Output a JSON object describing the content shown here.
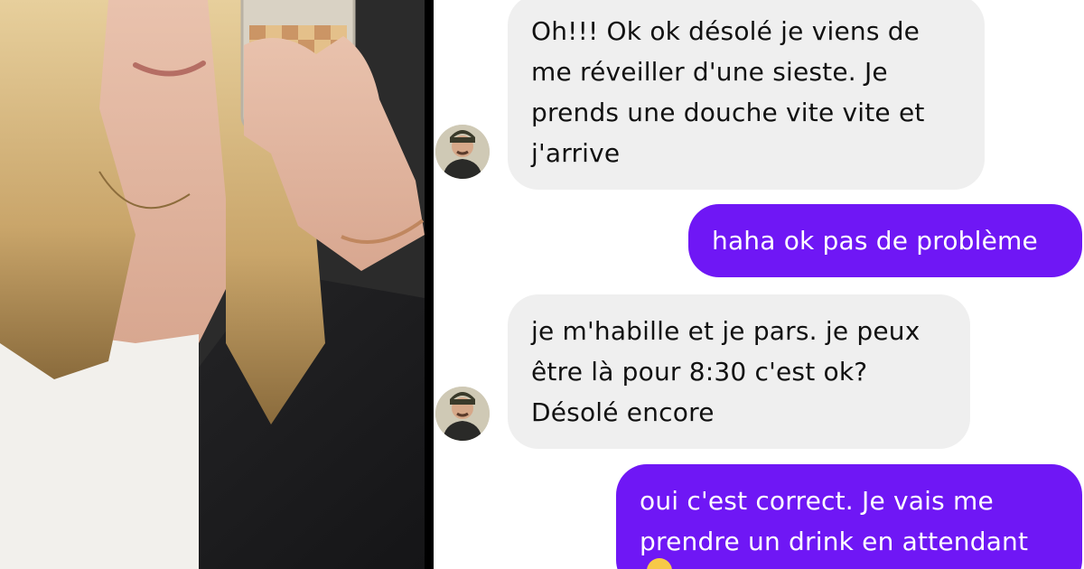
{
  "conversation": {
    "messages": [
      {
        "sender": "other",
        "text": "Oh!!! Ok ok désolé je viens de\nme réveiller d'une sieste. Je\nprends une douche vite vite et\nj'arrive"
      },
      {
        "sender": "me",
        "text": "haha ok pas de problème"
      },
      {
        "sender": "other",
        "text": "je m'habille et je pars. je peux\nêtre là pour 8:30 c'est ok?\nDésolé encore"
      },
      {
        "sender": "me",
        "text": "oui c'est correct. Je vais me\nprendre un drink en attendant"
      }
    ]
  },
  "colors": {
    "incoming_bubble": "#efefef",
    "outgoing_bubble": "#6f17f5",
    "background": "#ffffff"
  },
  "icons": [
    "avatar-photo",
    "emoji-icon"
  ]
}
